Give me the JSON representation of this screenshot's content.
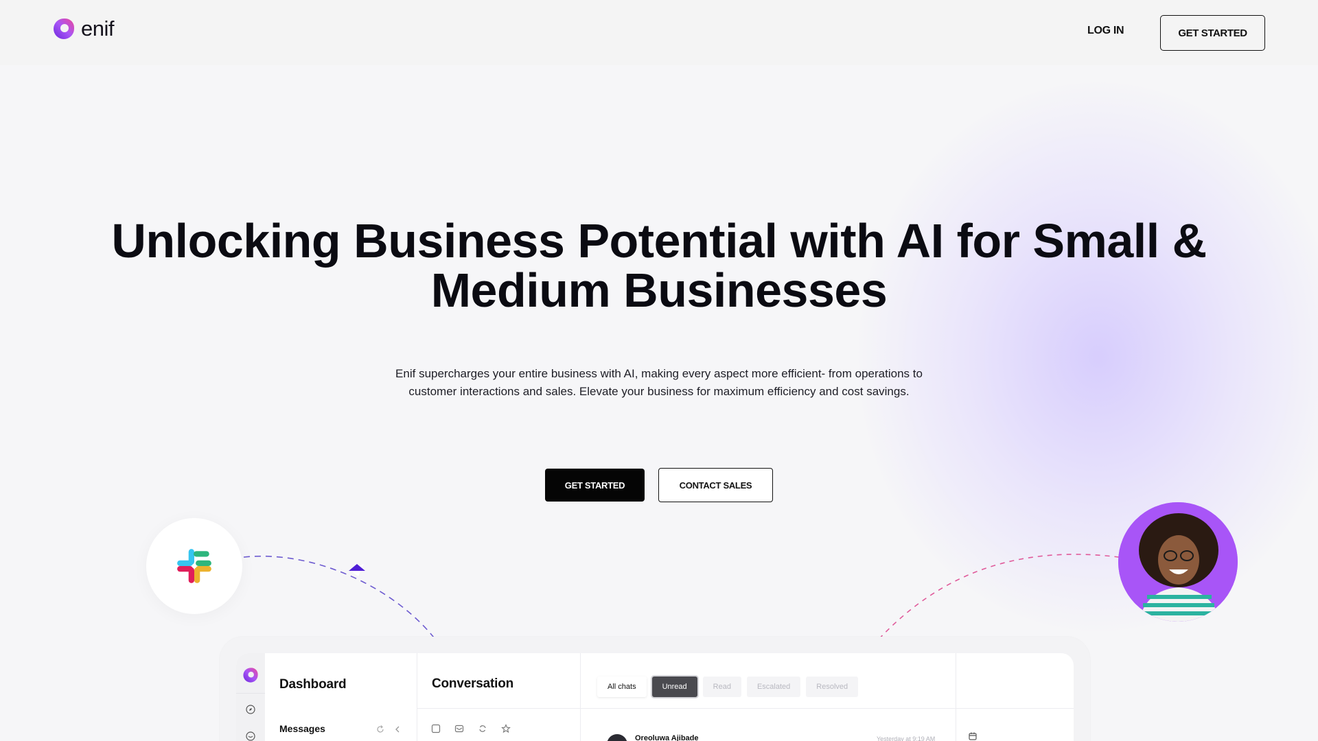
{
  "header": {
    "brand": "enif",
    "login_label": "LOG IN",
    "get_started_label": "GET STARTED"
  },
  "hero": {
    "title": "Unlocking Business Potential with AI for Small & Medium Businesses",
    "subtitle": "Enif supercharges your entire business with AI, making every aspect more efficient- from operations to customer interactions and sales. Elevate your business for maximum efficiency and cost savings.",
    "primary_cta": "GET STARTED",
    "secondary_cta": "CONTACT SALES"
  },
  "integrations": {
    "left_icon": "slack-icon",
    "right_avatar": "customer-avatar"
  },
  "dashboard": {
    "sidebar_title": "Dashboard",
    "sidebar_item": "Messages",
    "conversation_title": "Conversation",
    "tabs": [
      {
        "label": "All chats"
      },
      {
        "label": "Unread"
      },
      {
        "label": "Read"
      },
      {
        "label": "Escalated"
      },
      {
        "label": "Resolved"
      }
    ],
    "active_tab": "Unread",
    "first_row": {
      "name": "Oreoluwa Ajibade",
      "time": "Yesterday at 9:19 AM"
    }
  },
  "colors": {
    "accent": "#a855f7",
    "primary": "#050505",
    "glow": "#cdc0ff"
  }
}
